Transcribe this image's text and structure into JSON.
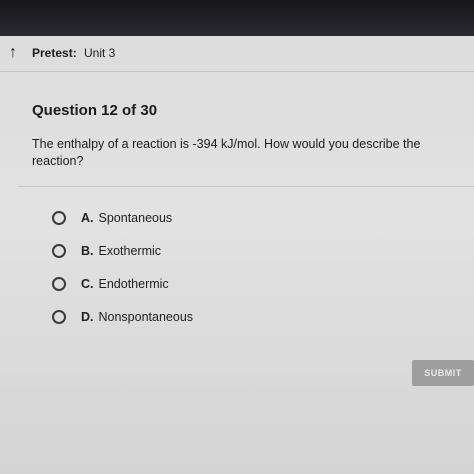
{
  "header": {
    "back_icon": "↑",
    "title": "Pretest:",
    "unit": "Unit 3"
  },
  "question": {
    "title": "Question 12 of 30",
    "text": "The enthalpy of a reaction is -394 kJ/mol. How would you describe the reaction?"
  },
  "options": [
    {
      "letter": "A.",
      "text": "Spontaneous"
    },
    {
      "letter": "B.",
      "text": "Exothermic"
    },
    {
      "letter": "C.",
      "text": "Endothermic"
    },
    {
      "letter": "D.",
      "text": "Nonspontaneous"
    }
  ],
  "submit_label": "SUBMIT"
}
